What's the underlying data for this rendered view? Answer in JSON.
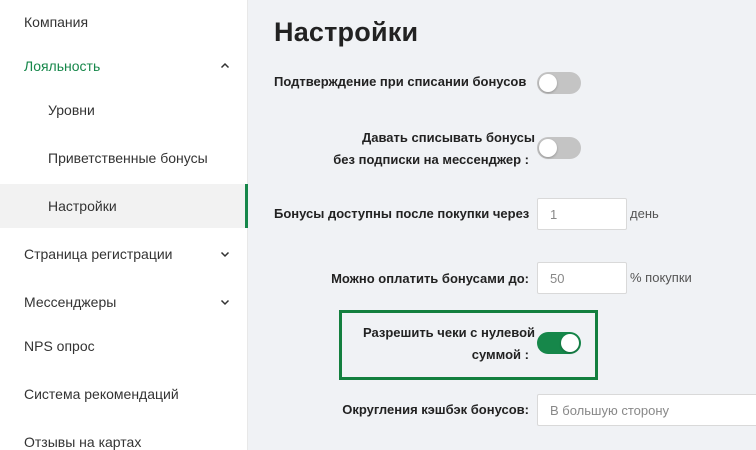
{
  "sidebar": {
    "items": [
      {
        "label": "Компания"
      },
      {
        "label": "Лояльность"
      },
      {
        "label": "Уровни"
      },
      {
        "label": "Приветственные бонусы"
      },
      {
        "label": "Настройки"
      },
      {
        "label": "Страница регистрации"
      },
      {
        "label": "Мессенджеры"
      },
      {
        "label": "NPS опрос"
      },
      {
        "label": "Система рекомендаций"
      },
      {
        "label": "Отзывы на картах"
      }
    ]
  },
  "main": {
    "title": "Настройки",
    "confirm_writeoff": {
      "label": "Подтверждение при списании бонусов",
      "enabled": false
    },
    "allow_without_sub": {
      "label_line1": "Давать списывать бонусы",
      "label_line2": "без подписки на мессенджер :",
      "enabled": false
    },
    "bonus_available": {
      "label": "Бонусы доступны после покупки через",
      "value": "1",
      "suffix": "день"
    },
    "pay_with_bonus": {
      "label": "Можно оплатить бонусами до:",
      "value": "50",
      "suffix": "% покупки"
    },
    "zero_receipts": {
      "label_line1": "Разрешить чеки с нулевой",
      "label_line2": "суммой :",
      "enabled": true
    },
    "rounding": {
      "label": "Округления кэшбэк бонусов:",
      "value": "В большую сторону"
    }
  },
  "colors": {
    "accent": "#16874a",
    "highlight_border": "#137f3e",
    "toggle_off": "#c4c4c4"
  }
}
